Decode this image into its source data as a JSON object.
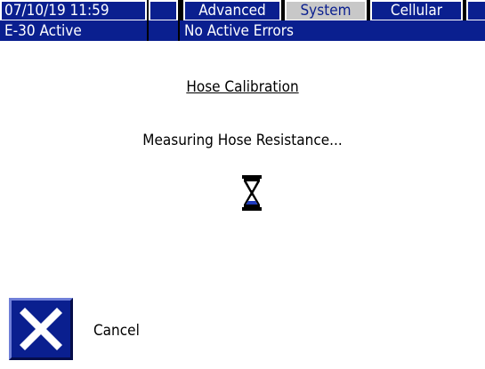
{
  "status_bar": {
    "datetime": "07/10/19 11:59",
    "tabs": [
      {
        "label": "Advanced",
        "selected": false
      },
      {
        "label": "System",
        "selected": true
      },
      {
        "label": "Cellular",
        "selected": false
      }
    ],
    "status": "E-30 Active",
    "errors": "No Active Errors"
  },
  "screen": {
    "title": "Hose Calibration",
    "message": "Measuring Hose Resistance...",
    "busy_icon": "hourglass-icon"
  },
  "actions": {
    "cancel_label": "Cancel",
    "cancel_icon": "close-x-icon"
  },
  "colors": {
    "header_blue": "#0a1f8f",
    "selected_tab": "#c8c8c8",
    "background": "#ffffff"
  }
}
